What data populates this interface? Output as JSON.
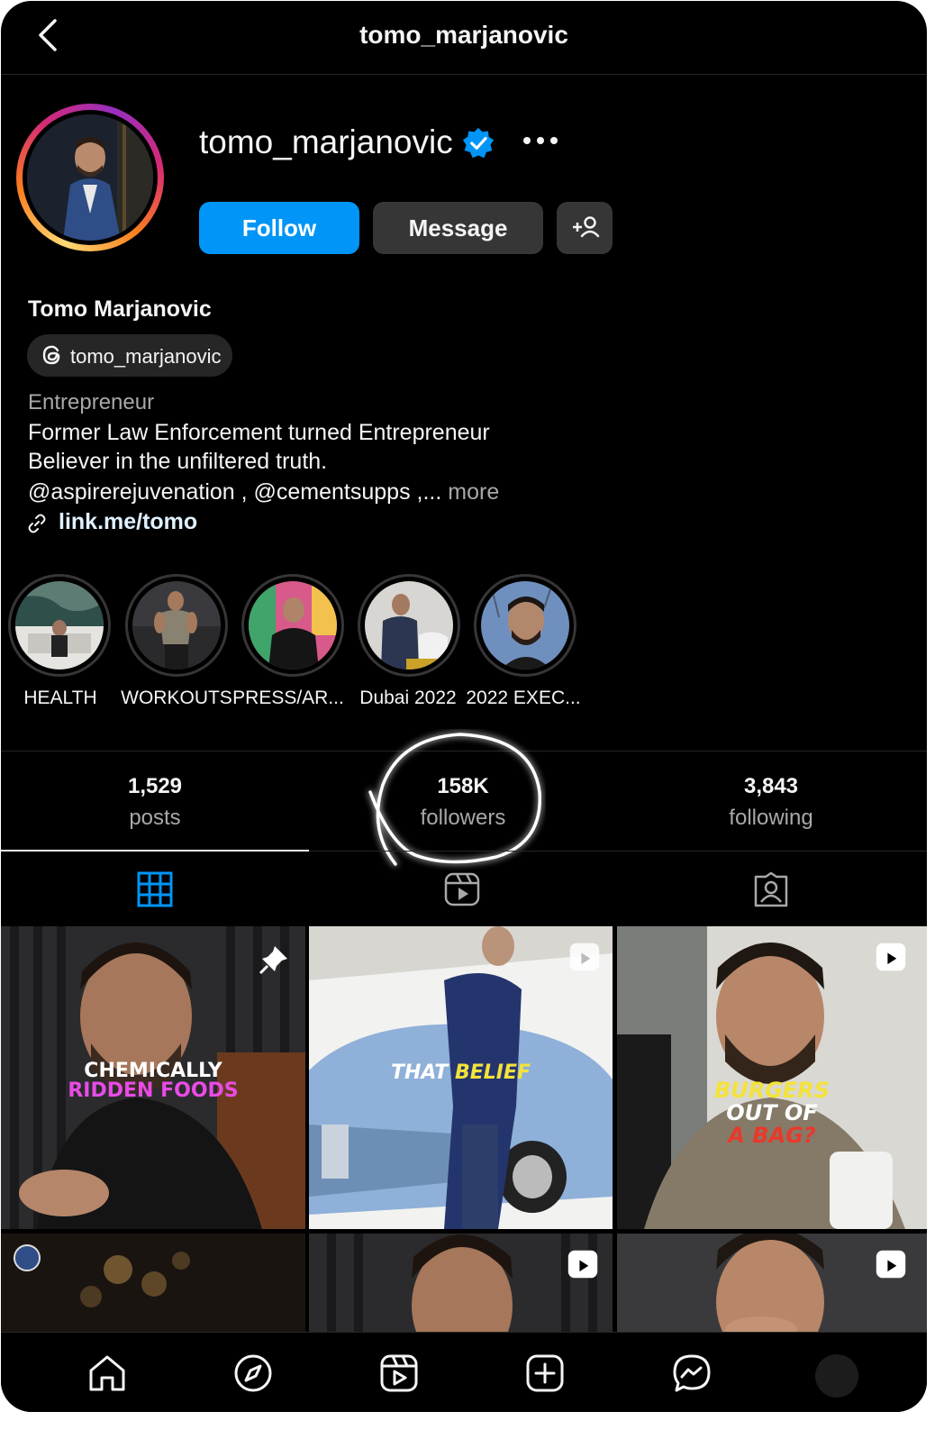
{
  "header": {
    "title": "tomo_marjanovic"
  },
  "profile": {
    "username": "tomo_marjanovic",
    "full_name": "Tomo Marjanovic",
    "threads_handle": "tomo_marjanovic",
    "category": "Entrepreneur",
    "bio_line1": "Former Law Enforcement turned Entrepreneur",
    "bio_line2": "Believer in the unfiltered truth.",
    "bio_line3": "@aspirerejuvenation , @cementsupps ,...",
    "bio_more": "more",
    "link": "link.me/tomo",
    "verified_color": "#0095f6"
  },
  "actions": {
    "follow": "Follow",
    "message": "Message"
  },
  "highlights": [
    {
      "label": "HEALTH"
    },
    {
      "label": "WORKOUTS"
    },
    {
      "label": "PRESS/AR..."
    },
    {
      "label": "Dubai 2022"
    },
    {
      "label": "2022 EXEC..."
    }
  ],
  "stats": {
    "posts": {
      "value": "1,529",
      "label": "posts"
    },
    "followers": {
      "value": "158K",
      "label": "followers"
    },
    "following": {
      "value": "3,843",
      "label": "following"
    }
  },
  "tabs": [
    "grid-icon",
    "reels-icon",
    "tagged-icon"
  ],
  "grid": {
    "post1_line1": "CHEMICALLY",
    "post1_line2": "RIDDEN FOODS",
    "post2_w1": "THAT",
    "post2_w2": "BELIEF",
    "post3_line1": "BURGERS",
    "post3_line2": "OUT OF",
    "post3_line3": "A BAG?"
  },
  "colors": {
    "accent": "#0095f6",
    "background": "#000000",
    "button": "#363636"
  }
}
